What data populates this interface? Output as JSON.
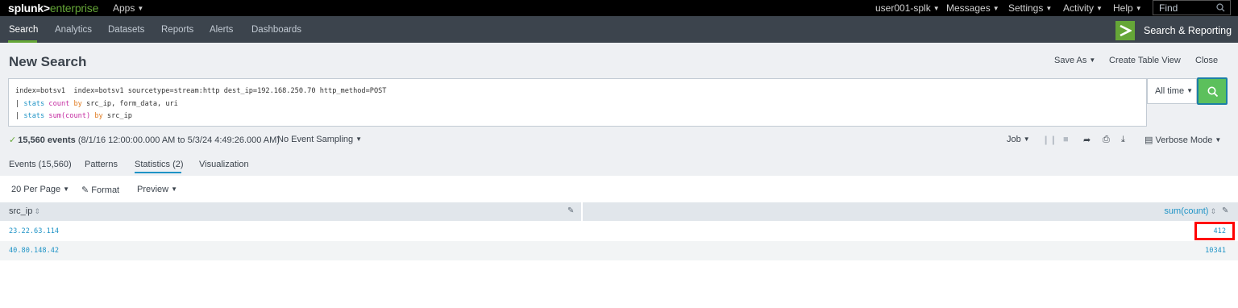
{
  "topbar": {
    "logo_main": "splunk>",
    "logo_sub": "enterprise",
    "apps": "Apps",
    "user": "user001-splk",
    "messages": "Messages",
    "settings": "Settings",
    "activity": "Activity",
    "help": "Help",
    "find_placeholder": "Find"
  },
  "appbar": {
    "tabs": [
      "Search",
      "Analytics",
      "Datasets",
      "Reports",
      "Alerts",
      "Dashboards"
    ],
    "active_tab": "Search",
    "app_title": "Search & Reporting"
  },
  "header": {
    "title": "New Search",
    "save_as": "Save As",
    "create_table_view": "Create Table View",
    "close": "Close"
  },
  "search": {
    "line1": "index=botsv1  index=botsv1 sourcetype=stream:http dest_ip=192.168.250.70 http_method=POST",
    "line2": {
      "pipe": "| ",
      "cmd": "stats",
      "fn": "count",
      "by": "by",
      "fields": "src_ip, form_data, uri"
    },
    "line3": {
      "pipe": "| ",
      "cmd": "stats",
      "fn": "sum(count)",
      "by": "by",
      "fields": "src_ip"
    },
    "time_range": "All time"
  },
  "status": {
    "check": "✓",
    "event_count": "15,560 events",
    "range": "(8/1/16 12:00:00.000 AM to 5/3/24 4:49:26.000 AM)",
    "sampling": "No Event Sampling",
    "job": "Job",
    "mode": "Verbose Mode"
  },
  "tabs": {
    "events": "Events (15,560)",
    "patterns": "Patterns",
    "statistics": "Statistics (2)",
    "visualization": "Visualization",
    "active": "Statistics (2)"
  },
  "toolbar": {
    "per_page": "20 Per Page",
    "format": "Format",
    "preview": "Preview"
  },
  "table": {
    "columns": [
      "src_ip",
      "sum(count)"
    ],
    "rows": [
      {
        "src_ip": "23.22.63.114",
        "sum": "412"
      },
      {
        "src_ip": "40.80.148.42",
        "sum": "10341"
      }
    ]
  },
  "colors": {
    "brand_green": "#65a637",
    "link_blue": "#1e93c6",
    "nav_bg": "#3c444d",
    "highlight": "#ff0000"
  },
  "icons": [
    "search-icon",
    "chevron-right-icon",
    "pause-icon",
    "stop-icon",
    "share-icon",
    "print-icon",
    "export-icon",
    "verbose-mode-icon",
    "pencil-icon",
    "sort-icon"
  ]
}
